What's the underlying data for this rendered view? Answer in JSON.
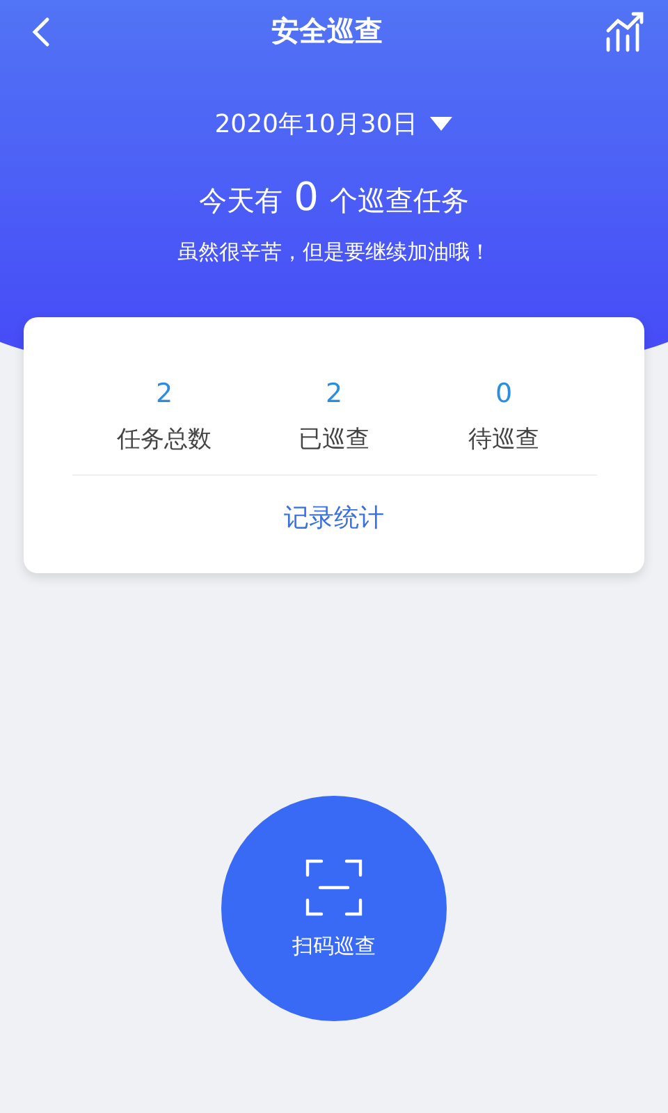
{
  "top_bar": {
    "title": "安全巡查"
  },
  "date_picker": {
    "value": "2020年10月30日"
  },
  "summary": {
    "prefix": "今天有",
    "count": "0",
    "suffix": "个巡查任务"
  },
  "slogan": "虽然很辛苦，但是要继续加油哦！",
  "stats": [
    {
      "value": "2",
      "label": "任务总数"
    },
    {
      "value": "2",
      "label": "已巡查"
    },
    {
      "value": "0",
      "label": "待巡查"
    }
  ],
  "record_link": "记录统计",
  "scan_button": {
    "label": "扫码巡查"
  }
}
